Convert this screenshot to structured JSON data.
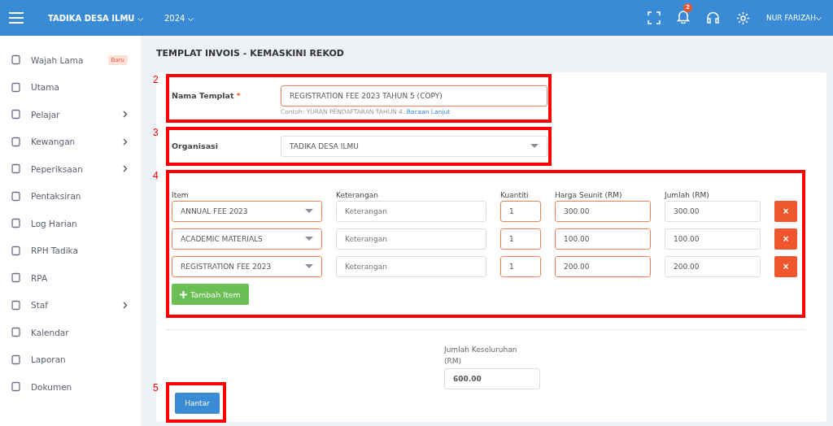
{
  "topbar": {
    "org": "TADIKA DESA ILMU",
    "year": "2024",
    "notifications": "2",
    "user": "NUR FARIZAH"
  },
  "sidebar": {
    "items": [
      {
        "label": "Wajah Lama",
        "badge": "Baru",
        "has_children": false
      },
      {
        "label": "Utama",
        "has_children": false
      },
      {
        "label": "Pelajar",
        "has_children": true
      },
      {
        "label": "Kewangan",
        "has_children": true
      },
      {
        "label": "Peperiksaan",
        "has_children": true
      },
      {
        "label": "Pentaksiran",
        "has_children": false
      },
      {
        "label": "Log Harian",
        "has_children": false
      },
      {
        "label": "RPH Tadika",
        "has_children": false
      },
      {
        "label": "RPA",
        "has_children": false
      },
      {
        "label": "Staf",
        "has_children": true
      },
      {
        "label": "Kalendar",
        "has_children": false
      },
      {
        "label": "Laporan",
        "has_children": false
      },
      {
        "label": "Dokumen",
        "has_children": false
      }
    ]
  },
  "page_title": "TEMPLAT INVOIS - KEMASKINI REKOD",
  "name_field": {
    "annotation": "2",
    "label": "Nama Templat",
    "required": true,
    "required_mark": "*",
    "value": "REGISTRATION FEE 2023 TAHUN 5 (COPY)",
    "hint": "Contoh: YURAN PENDAFTARAN TAHUN 4.",
    "hint_link": "Bacaan Lanjut"
  },
  "org_field": {
    "annotation": "3",
    "label": "Organisasi",
    "required": false,
    "value": "TADIKA DESA ILMU"
  },
  "items_section": {
    "annotation": "4",
    "columns": [
      {
        "label": "Item",
        "required": true
      },
      {
        "label": "Keterangan",
        "required": false
      },
      {
        "label": "Kuantiti",
        "required": true
      },
      {
        "label": "Harga Seunit (RM)",
        "required": true
      },
      {
        "label": "Jumlah (RM)",
        "required": false
      }
    ],
    "rows": [
      {
        "item": "ANNUAL FEE 2023",
        "description_placeholder": "Keterangan",
        "quantity": "1",
        "unit_price": "300.00",
        "amount": "300.00",
        "remove": "×"
      },
      {
        "item": "ACADEMIC MATERIALS",
        "description_placeholder": "Keterangan",
        "quantity": "1",
        "unit_price": "100.00",
        "amount": "100.00",
        "remove": "×"
      },
      {
        "item": "REGISTRATION FEE 2023",
        "description_placeholder": "Keterangan",
        "quantity": "1",
        "unit_price": "200.00",
        "amount": "200.00",
        "remove": "×"
      }
    ],
    "add_button": "Tambah Item"
  },
  "total": {
    "label": "Jumlah Keseluruhan (RM)",
    "value": "600.00"
  },
  "submit": {
    "annotation": "5",
    "label": "Hantar"
  }
}
